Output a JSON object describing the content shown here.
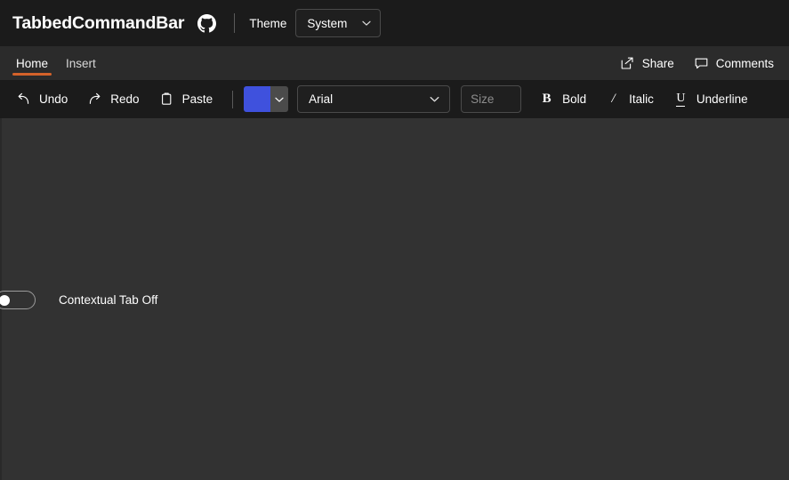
{
  "titlebar": {
    "app_title": "TabbedCommandBar",
    "github_icon": "github-icon",
    "theme_label": "Theme",
    "theme_value": "System",
    "theme_options": [
      "System"
    ]
  },
  "tabstrip": {
    "tabs": [
      {
        "label": "Home",
        "active": true
      },
      {
        "label": "Insert",
        "active": false
      }
    ],
    "actions": [
      {
        "label": "Share",
        "icon": "share-icon"
      },
      {
        "label": "Comments",
        "icon": "comment-icon"
      }
    ],
    "accent_color": "#d4622a"
  },
  "commandbar": {
    "undo_label": "Undo",
    "redo_label": "Redo",
    "paste_label": "Paste",
    "color_value": "#3f51dd",
    "font_value": "Arial",
    "size_placeholder": "Size",
    "size_value": "",
    "bold_label": "Bold",
    "bold_glyph": "B",
    "italic_label": "Italic",
    "italic_glyph": "/",
    "underline_label": "Underline",
    "underline_glyph": "U"
  },
  "content": {
    "toggle_label": "Contextual Tab Off",
    "toggle_state": "off"
  },
  "colors": {
    "titlebar_bg": "#1b1b1b",
    "tabstrip_bg": "#2b2b2b",
    "commandbar_bg": "#1b1b1b",
    "content_bg": "#323232",
    "accent": "#d4622a",
    "swatch": "#3f51dd"
  }
}
